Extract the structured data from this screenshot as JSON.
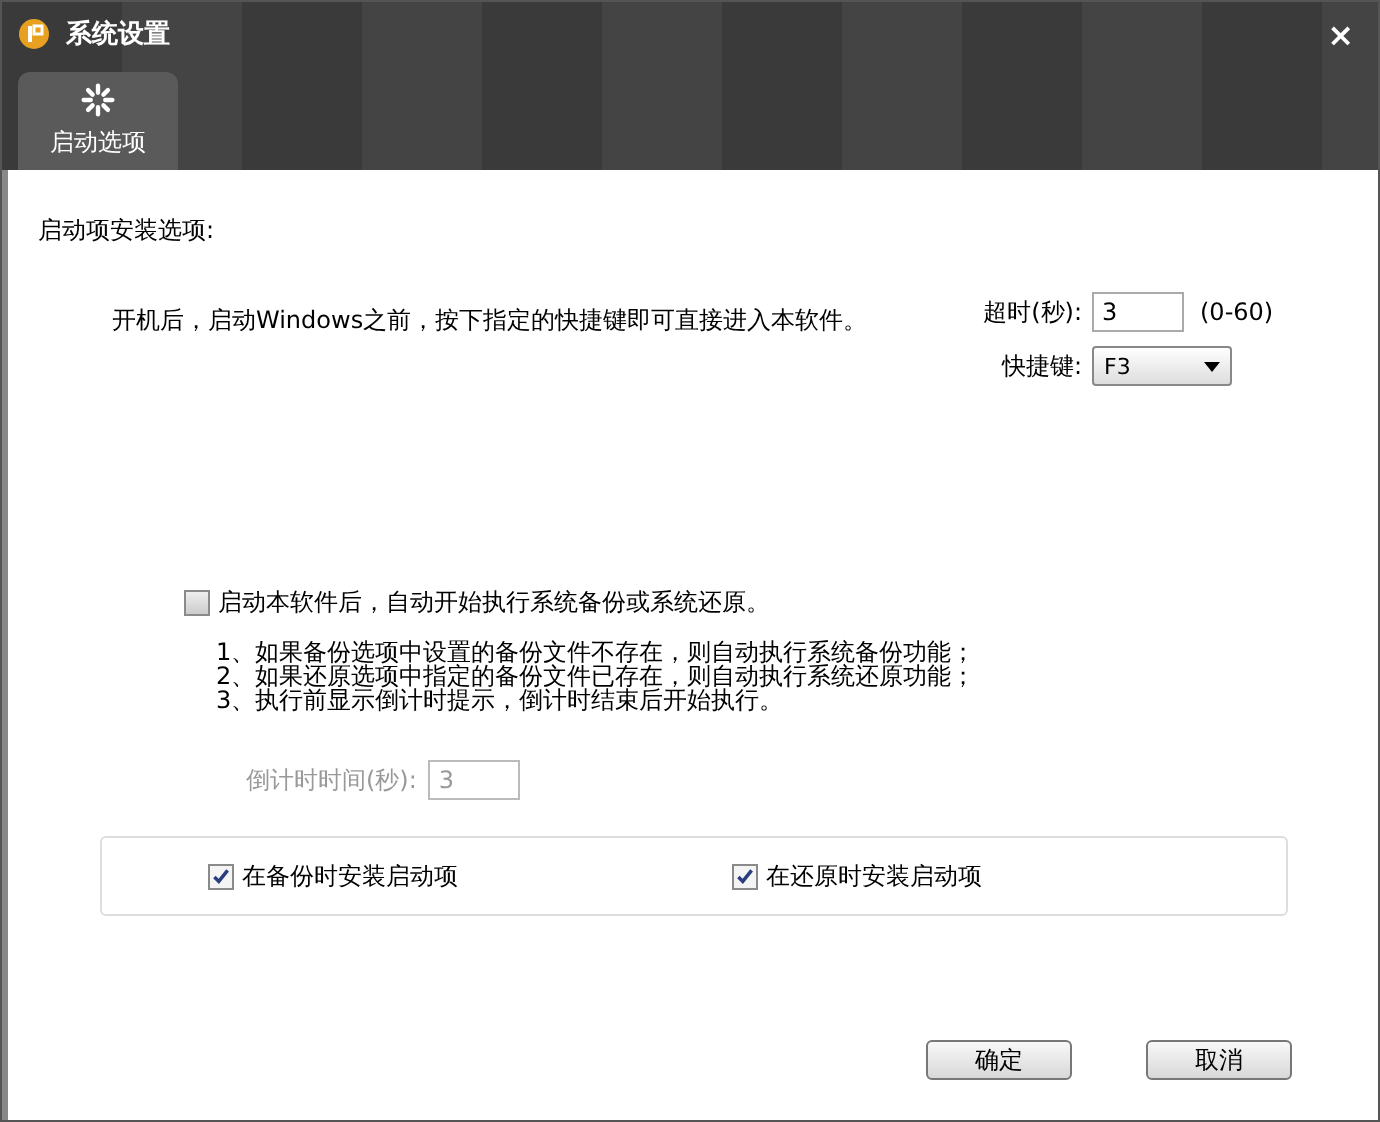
{
  "window": {
    "title": "系统设置",
    "close": "×"
  },
  "tabs": [
    {
      "label": "启动选项",
      "selected": true
    }
  ],
  "section_title": "启动项安装选项:",
  "description": "开机后，启动Windows之前，按下指定的快捷键即可直接进入本软件。",
  "timeout": {
    "label": "超时(秒):",
    "value": "3",
    "range": "(0-60)"
  },
  "hotkey": {
    "label": "快捷键:",
    "value": "F3"
  },
  "auto_run": {
    "label": "启动本软件后，自动开始执行系统备份或系统还原。",
    "checked": false
  },
  "notes": [
    "1、如果备份选项中设置的备份文件不存在，则自动执行系统备份功能；",
    "2、如果还原选项中指定的备份文件已存在，则自动执行系统还原功能；",
    "3、执行前显示倒计时提示，倒计时结束后开始执行。"
  ],
  "countdown": {
    "label": "倒计时时间(秒):",
    "value": "3",
    "disabled": true
  },
  "install_options": [
    {
      "label": "在备份时安装启动项",
      "checked": true
    },
    {
      "label": "在还原时安装启动项",
      "checked": true
    }
  ],
  "buttons": [
    "确定",
    "取消"
  ]
}
